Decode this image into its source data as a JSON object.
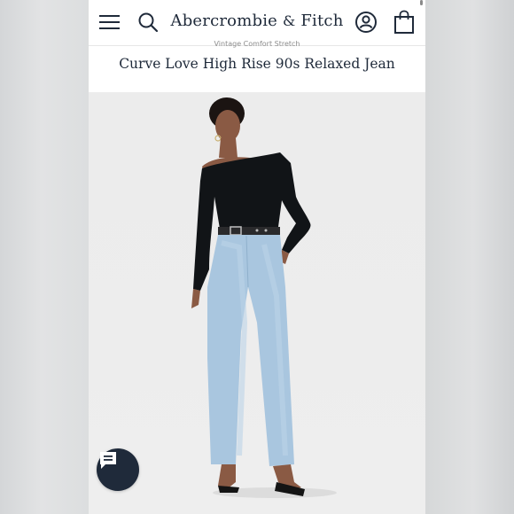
{
  "header": {
    "brand_name": "Abercrombie",
    "brand_amp": "&",
    "brand_suffix": "Fitch",
    "icons": {
      "menu": "hamburger-menu-icon",
      "search": "search-icon",
      "account": "account-icon",
      "bag": "shopping-bag-icon"
    }
  },
  "product": {
    "collection_label": "Vintage Comfort Stretch",
    "title": "Curve Love High Rise 90s Relaxed Jean"
  },
  "chat": {
    "icon": "chat-bubble-icon"
  },
  "colors": {
    "brand_navy": "#1f2a3a",
    "background": "#ffffff",
    "photo_background": "#ececec"
  }
}
